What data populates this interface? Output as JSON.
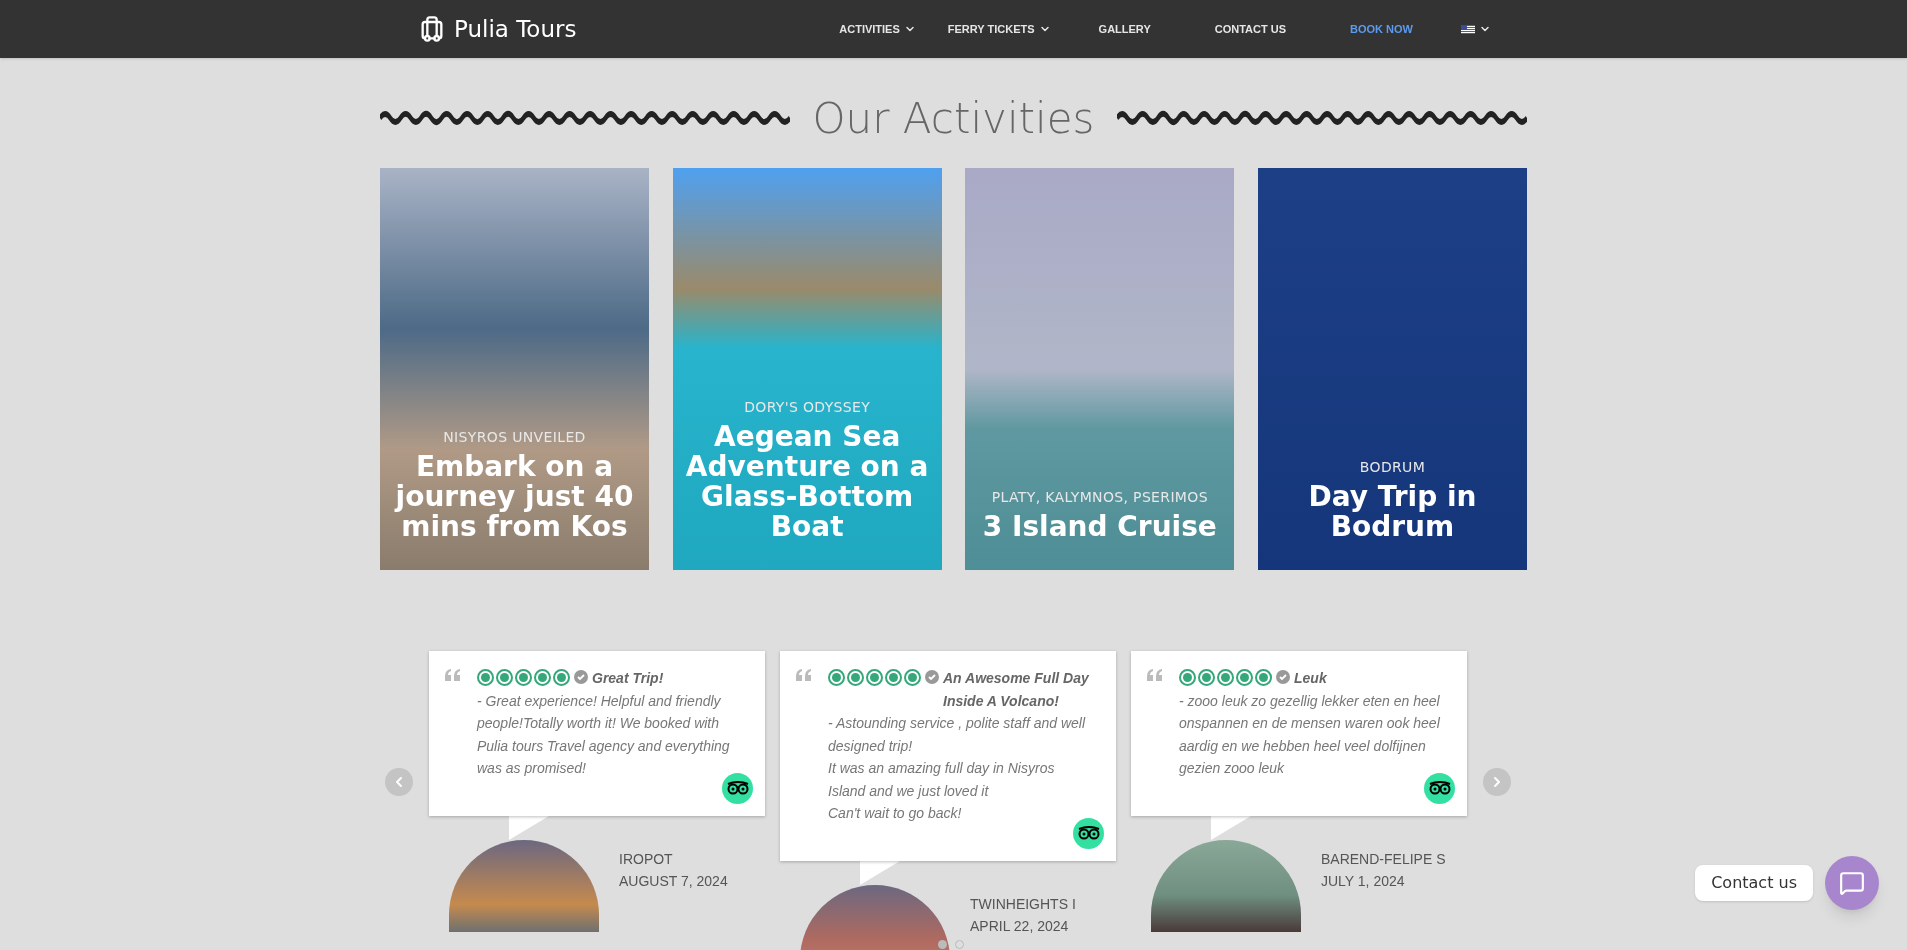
{
  "navbar": {
    "logo": "Pulia Tours",
    "items": [
      {
        "label": "ACTIVITIES",
        "kind": "dropdown"
      },
      {
        "label": "FERRY TICKETS",
        "kind": "dropdown"
      },
      {
        "label": "GALLERY",
        "kind": "link"
      },
      {
        "label": "CONTACT US",
        "kind": "link"
      },
      {
        "label": "BOOK NOW",
        "kind": "cta"
      },
      {
        "kind": "language"
      }
    ]
  },
  "heading": "Our Activities",
  "activities": [
    {
      "subtitle": "NISYROS UNVEILED",
      "title": "Embark on a journey just 40 mins from Kos"
    },
    {
      "subtitle": "DORY'S ODYSSEY",
      "title": "Aegean Sea Adventure on a Glass-Bottom Boat"
    },
    {
      "subtitle": "PLATY, KALYMNOS, PSERIMOS",
      "title": "3 Island Cruise"
    },
    {
      "subtitle": "BODRUM",
      "title": "Day Trip in Bodrum"
    }
  ],
  "reviews": [
    {
      "stars": 5,
      "verified": true,
      "title": "Great Trip!",
      "text": " - Great experience! Helpful and friendly people!Totally worth it! We booked with Pulia tours Travel agency and everything was as promised!",
      "author": "IROPOT",
      "date": "AUGUST 7, 2024"
    },
    {
      "stars": 5,
      "verified": true,
      "title": "An Awesome Full Day Inside A Volcano!",
      "text": " - Astounding service , polite staff and well designed trip!\nIt was an amazing full day in Nisyros Island and we just loved it\nCan't wait to go back!",
      "author": "TWINHEIGHTS I",
      "date": "APRIL 22, 2024"
    },
    {
      "stars": 5,
      "verified": true,
      "title": "Leuk",
      "text": " - zooo leuk zo gezellig lekker eten en heel onspannen en de mensen waren ook heel aardig en we hebben heel veel dolfijnen gezien zooo leuk",
      "author": "BAREND-FELIPE S",
      "date": "JULY 1, 2024"
    }
  ],
  "pagination": [
    {
      "selected": true
    },
    {
      "selected": false
    }
  ],
  "contact_widget": {
    "label": "Contact us"
  }
}
